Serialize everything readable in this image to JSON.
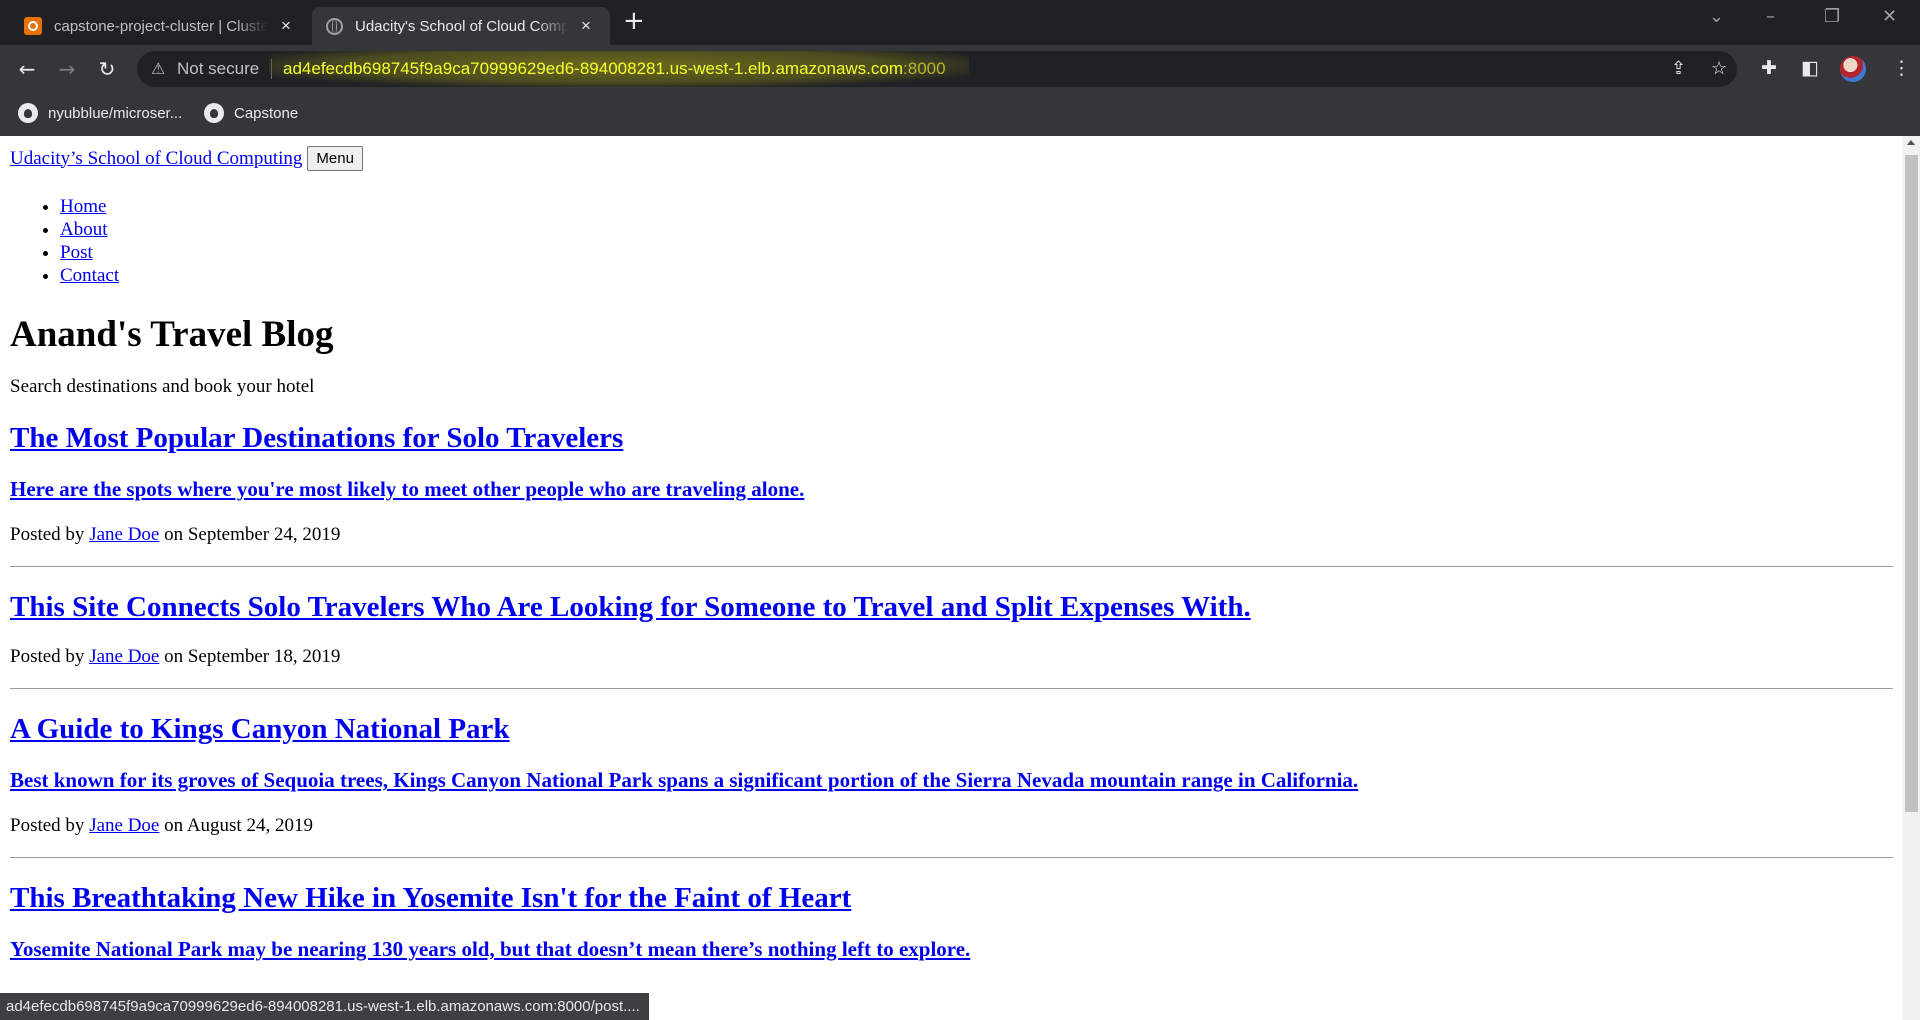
{
  "browser": {
    "tabs": [
      {
        "title": "capstone-project-cluster | Cluster",
        "close_icon": "×"
      },
      {
        "title": "Udacity's School of Cloud Computing",
        "close_icon": "×"
      }
    ],
    "new_tab_icon": "+",
    "address": {
      "security_label": "Not secure",
      "url_host": "ad4efecdb698745f9a9ca70999629ed6-894008281.us-west-1.elb.amazonaws.com",
      "url_port": ":8000"
    },
    "bookmarks": [
      {
        "label": "nyubblue/microser..."
      },
      {
        "label": "Capstone"
      }
    ],
    "status_url": "ad4efecdb698745f9a9ca70999629ed6-894008281.us-west-1.elb.amazonaws.com:8000/post...."
  },
  "site": {
    "brand": "Udacity’s School of Cloud Computing",
    "menu_button": "Menu",
    "nav": [
      "Home",
      "About",
      "Post",
      "Contact"
    ],
    "heading": "Anand's Travel Blog",
    "subheading": "Search destinations and book your hotel",
    "posted_by": "Posted by",
    "on": "on"
  },
  "posts": [
    {
      "title": "The Most Popular Destinations for Solo Travelers",
      "subtitle": "Here are the spots where you're most likely to meet other people who are traveling alone.",
      "author": "Jane Doe",
      "date": "September 24, 2019"
    },
    {
      "title": "This Site Connects Solo Travelers Who Are Looking for Someone to Travel and Split Expenses With.",
      "author": "Jane Doe",
      "date": "September 18, 2019"
    },
    {
      "title": "A Guide to Kings Canyon National Park",
      "subtitle": "Best known for its groves of Sequoia trees, Kings Canyon National Park spans a significant portion of the Sierra Nevada mountain range in California.",
      "author": "Jane Doe",
      "date": "August 24, 2019"
    },
    {
      "title": "This Breathtaking New Hike in Yosemite Isn't for the Faint of Heart",
      "subtitle": "Yosemite National Park may be nearing 130 years old, but that doesn’t mean there’s nothing left to explore."
    }
  ]
}
